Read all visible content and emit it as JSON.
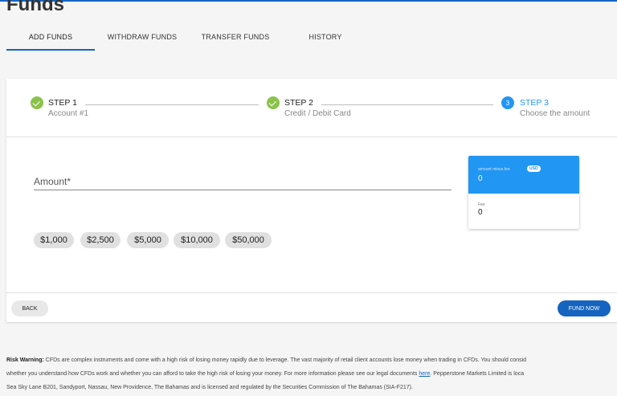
{
  "page": {
    "title": "Funds"
  },
  "tabs": [
    {
      "label": "ADD FUNDS",
      "active": true
    },
    {
      "label": "WITHDRAW FUNDS"
    },
    {
      "label": "TRANSFER FUNDS"
    },
    {
      "label": "HISTORY"
    }
  ],
  "stepper": {
    "steps": [
      {
        "title": "STEP 1",
        "subtitle": "Account #1",
        "status": "done",
        "icon": "check-icon"
      },
      {
        "title": "STEP 2",
        "subtitle": "Credit / Debit Card",
        "status": "done",
        "icon": "check-icon"
      },
      {
        "title": "STEP 3",
        "subtitle": "Choose the amount",
        "status": "current",
        "number": "3"
      }
    ]
  },
  "form": {
    "amount_label": "Amount*",
    "quick_amounts": [
      "$1,000",
      "$2,500",
      "$5,000",
      "$10,000",
      "$50,000"
    ]
  },
  "fee_card": {
    "amount_minus_fee_label": "amount minus fee",
    "currency_badge": "USD",
    "amount_minus_fee_value": "0",
    "fee_label": "Fee",
    "fee_value": "0"
  },
  "actions": {
    "back_label": "BACK",
    "fund_now_label": "FUND NOW"
  },
  "risk_warning": {
    "bold_label": "Risk Warning:",
    "line1": " CFDs are complex instruments and come with a high risk of losing money rapidly due to leverage. The vast majority of retail client accounts lose money when trading in CFDs. You should consid",
    "line2_before_link": "whether you understand how CFDs work and whether you can afford to take the high risk of losing your money. For more information please see our legal documents ",
    "link_text": "here",
    "line2_after_link": ". Pepperstone Markets Limited is loca",
    "line3": "Sea Sky Lane B201, Sandyport, Nassau, New Providence, The Bahamas and is licensed and regulated by the Securities Commission of The Bahamas (SIA-F217)."
  },
  "colors": {
    "primary": "#1565c0",
    "accent": "#2196f3",
    "success": "#8bc34a"
  }
}
